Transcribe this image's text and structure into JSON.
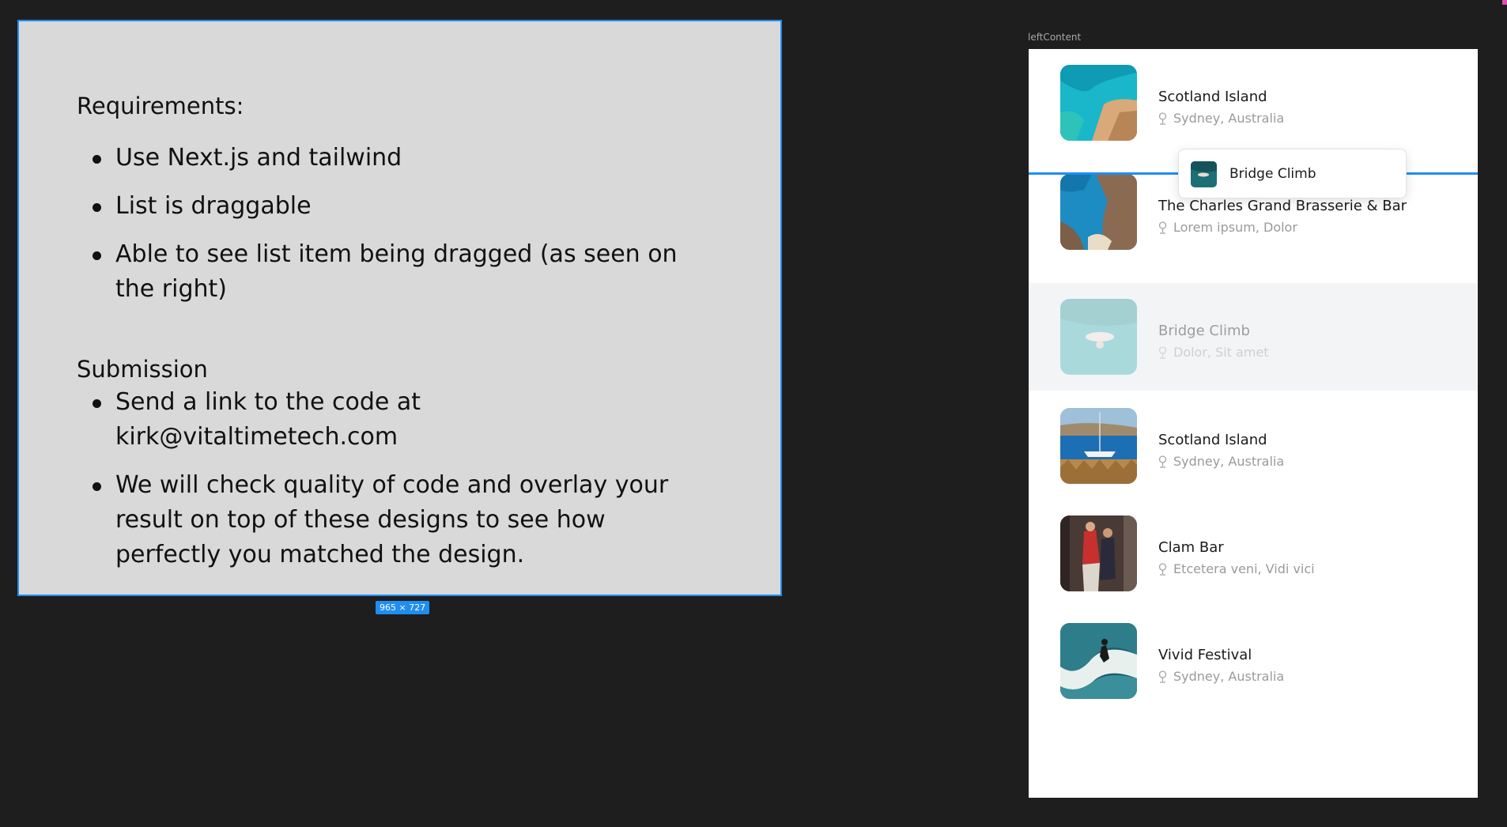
{
  "requirements": {
    "heading": "Requirements:",
    "items": [
      "Use Next.js and tailwind",
      "List is draggable",
      "Able to see list item being dragged (as seen on the right)"
    ],
    "submission_heading": "Submission",
    "submission_items": [
      "Send a link to the code at kirk@vitaltimetech.com",
      "We will check quality of code and overlay your result on top of these designs to see how perfectly you matched the design."
    ],
    "size_badge": "965 × 727"
  },
  "panel": {
    "label": "leftContent",
    "items": [
      {
        "title": "Scotland Island",
        "location": "Sydney, Australia",
        "image": "turquoise-coast-cliffs"
      },
      {
        "title": "The Charles Grand Brasserie & Bar",
        "location": "Lorem ipsum, Dolor",
        "image": "rocky-cove-beach"
      },
      {
        "title": "Bridge Climb",
        "location": "Dolor, Sit amet",
        "image": "swimmer-in-blue-water",
        "state": "placeholder"
      },
      {
        "title": "Scotland Island",
        "location": "Sydney, Australia",
        "image": "sailboat-harbor"
      },
      {
        "title": "Clam Bar",
        "location": "Etcetera veni, Vidi vici",
        "image": "dancers-in-street"
      },
      {
        "title": "Vivid Festival",
        "location": "Sydney, Australia",
        "image": "surfer-on-wave"
      }
    ],
    "drag_preview": {
      "title": "Bridge Climb",
      "image": "swimmer-in-blue-water"
    }
  },
  "colors": {
    "canvas": "#1e1e1e",
    "frame": "#d9d9d9",
    "selection": "#1f8ef1",
    "panel": "#ffffff",
    "placeholder_row": "#f3f4f6"
  }
}
